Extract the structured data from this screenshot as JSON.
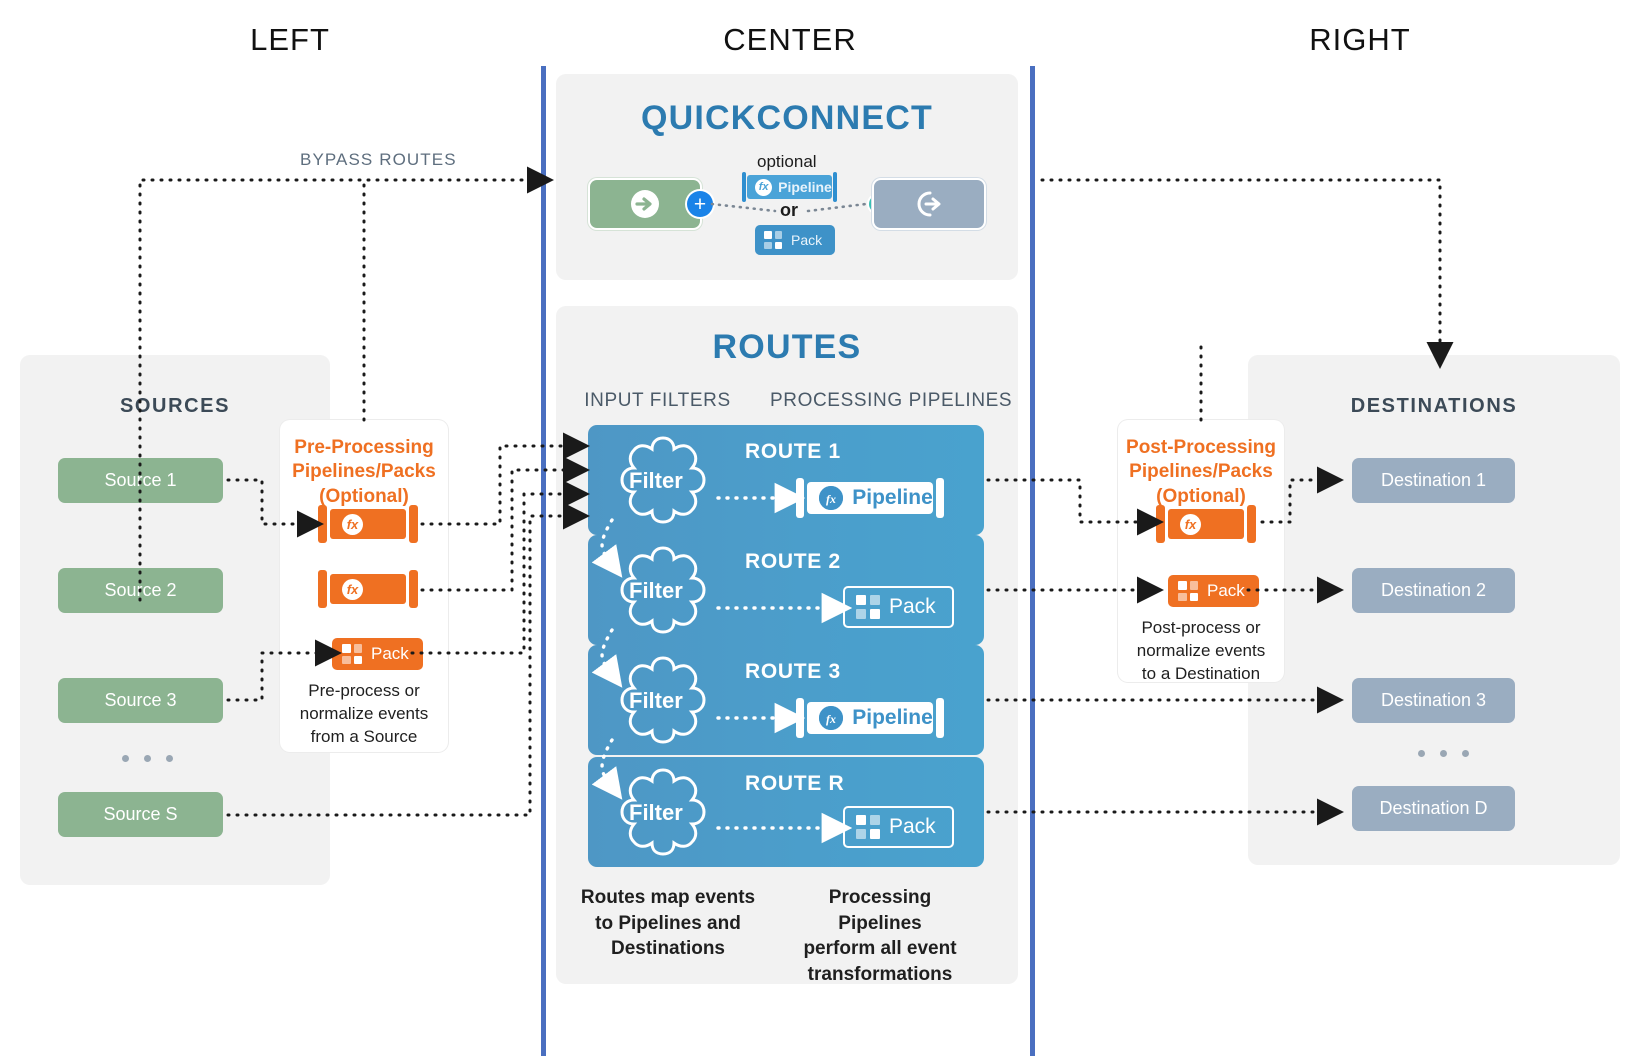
{
  "columns": {
    "left": "LEFT",
    "center": "CENTER",
    "right": "RIGHT"
  },
  "colors": {
    "divider": "#4a6fc0",
    "source": "#8cb491",
    "destination": "#9aadc1",
    "orange": "#ef7022",
    "route_blue": "#4b9ecb",
    "title_blue": "#2c7bb0",
    "plus_blue": "#1a83e8",
    "teal_dot": "#37bfb4",
    "panel_grey": "#f2f2f2"
  },
  "bypass": {
    "label": "BYPASS ROUTES"
  },
  "sources": {
    "title": "SOURCES",
    "items": [
      {
        "label": "Source 1"
      },
      {
        "label": "Source 2"
      },
      {
        "label": "Source 3"
      },
      {
        "label": "Source S"
      }
    ],
    "ellipsis": "• • •"
  },
  "preprocessing": {
    "title": "Pre-Processing\nPipelines/Packs\n(Optional)",
    "title_line1": "Pre-Processing",
    "title_line2": "Pipelines/Packs",
    "title_line3": "(Optional)",
    "pipeline_icon_label": "fx",
    "pack_label": "Pack",
    "caption_line1": "Pre-process or",
    "caption_line2": "normalize events",
    "caption_line3": "from a Source"
  },
  "quickconnect": {
    "title": "QUICKCONNECT",
    "optional_label": "optional",
    "or_label": "or",
    "pipeline_label": "Pipeline",
    "pipeline_icon_label": "fx",
    "pack_label": "Pack",
    "source_icon": "source-arrow-in-icon",
    "destination_icon": "destination-arrow-out-icon",
    "plus_label": "+"
  },
  "routes_panel": {
    "title": "ROUTES",
    "col_headers": {
      "filters": "INPUT FILTERS",
      "pipelines": "PROCESSING PIPELINES"
    },
    "filter_label": "Filter",
    "rows": [
      {
        "name": "ROUTE 1",
        "target_type": "pipeline",
        "target_label": "Pipeline"
      },
      {
        "name": "ROUTE 2",
        "target_type": "pack",
        "target_label": "Pack"
      },
      {
        "name": "ROUTE 3",
        "target_type": "pipeline",
        "target_label": "Pipeline"
      },
      {
        "name": "ROUTE R",
        "target_type": "pack",
        "target_label": "Pack"
      }
    ],
    "caption_left_line1": "Routes map events",
    "caption_left_line2": "to Pipelines and",
    "caption_left_line3": "Destinations",
    "caption_right_line1": "Processing Pipelines",
    "caption_right_line2": "perform all event",
    "caption_right_line3": "transformations"
  },
  "postprocessing": {
    "title_line1": "Post-Processing",
    "title_line2": "Pipelines/Packs",
    "title_line3": "(Optional)",
    "pipeline_icon_label": "fx",
    "pack_label": "Pack",
    "caption_line1": "Post-process or",
    "caption_line2": "normalize events",
    "caption_line3": "to a Destination"
  },
  "destinations": {
    "title": "DESTINATIONS",
    "items": [
      {
        "label": "Destination 1"
      },
      {
        "label": "Destination 2"
      },
      {
        "label": "Destination 3"
      },
      {
        "label": "Destination D"
      }
    ],
    "ellipsis": "• • •"
  }
}
